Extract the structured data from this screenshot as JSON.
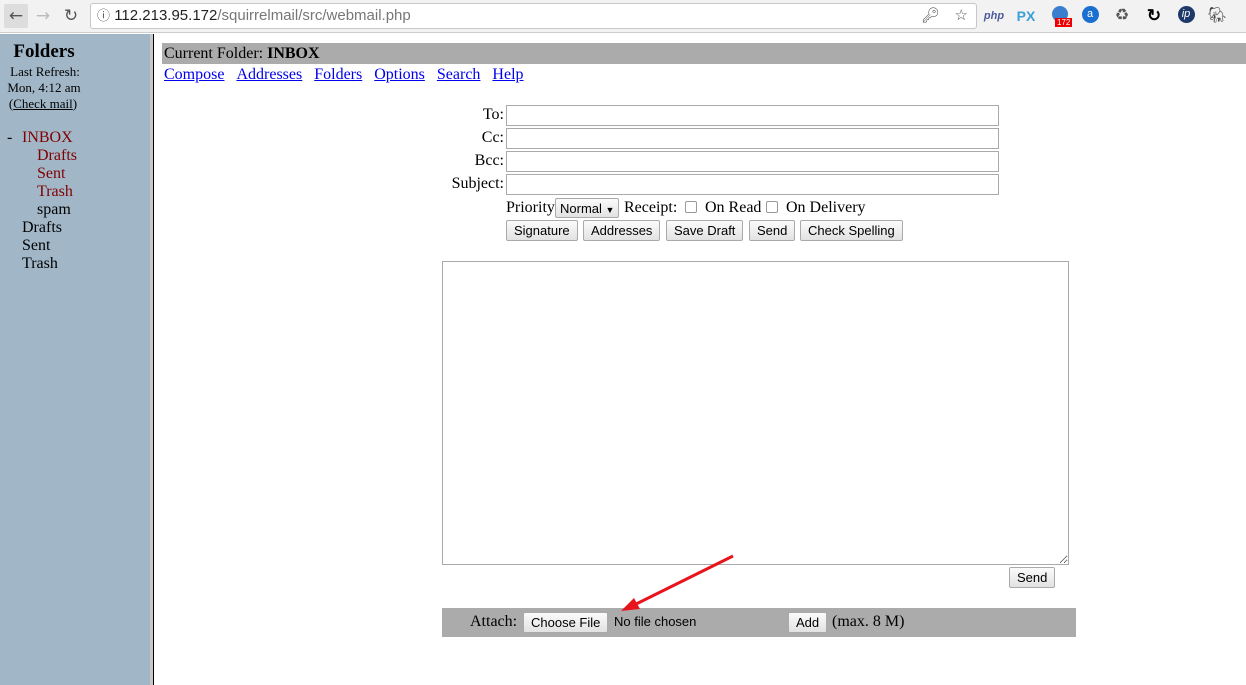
{
  "browser": {
    "url_host": "112.213.95.172",
    "url_path": "/squirrelmail/src/webmail.php",
    "extensions": [
      "php",
      "PX",
      "172",
      "a",
      "recycle",
      "sync",
      "ip",
      "evernote"
    ],
    "ext_badge": "172"
  },
  "sidebar": {
    "title": "Folders",
    "last_refresh_label": "Last Refresh:",
    "last_refresh_time": "Mon, 4:12 am",
    "check_mail": "Check mail",
    "collapse": "-",
    "folders": [
      {
        "label": "INBOX",
        "unread": true
      },
      {
        "label": "Drafts",
        "unread": true
      },
      {
        "label": "Sent",
        "unread": true
      },
      {
        "label": "Trash",
        "unread": true
      },
      {
        "label": "spam"
      },
      {
        "label": "Drafts"
      },
      {
        "label": "Sent"
      },
      {
        "label": "Trash"
      }
    ]
  },
  "header": {
    "current_folder_label": "Current Folder:",
    "current_folder": "INBOX"
  },
  "nav": [
    "Compose",
    "Addresses",
    "Folders",
    "Options",
    "Search",
    "Help"
  ],
  "compose": {
    "to_label": "To:",
    "cc_label": "Cc:",
    "bcc_label": "Bcc:",
    "subject_label": "Subject:",
    "to": "",
    "cc": "",
    "bcc": "",
    "subject": "",
    "priority_label": "Priority",
    "priority": "Normal",
    "receipt_label": "Receipt:",
    "on_read": "On Read",
    "on_delivery": "On Delivery",
    "buttons": [
      "Signature",
      "Addresses",
      "Save Draft",
      "Send",
      "Check Spelling"
    ],
    "body": "",
    "send_bottom": "Send"
  },
  "attach": {
    "label": "Attach:",
    "choose_file": "Choose File",
    "no_file": "No file chosen",
    "add": "Add",
    "max": "(max. 8 M)"
  },
  "colors": {
    "sidebar": "#a1b7c8",
    "bar": "#ababab",
    "unread": "#800000",
    "link": "#0000ee",
    "arrow": "#e8141c"
  }
}
